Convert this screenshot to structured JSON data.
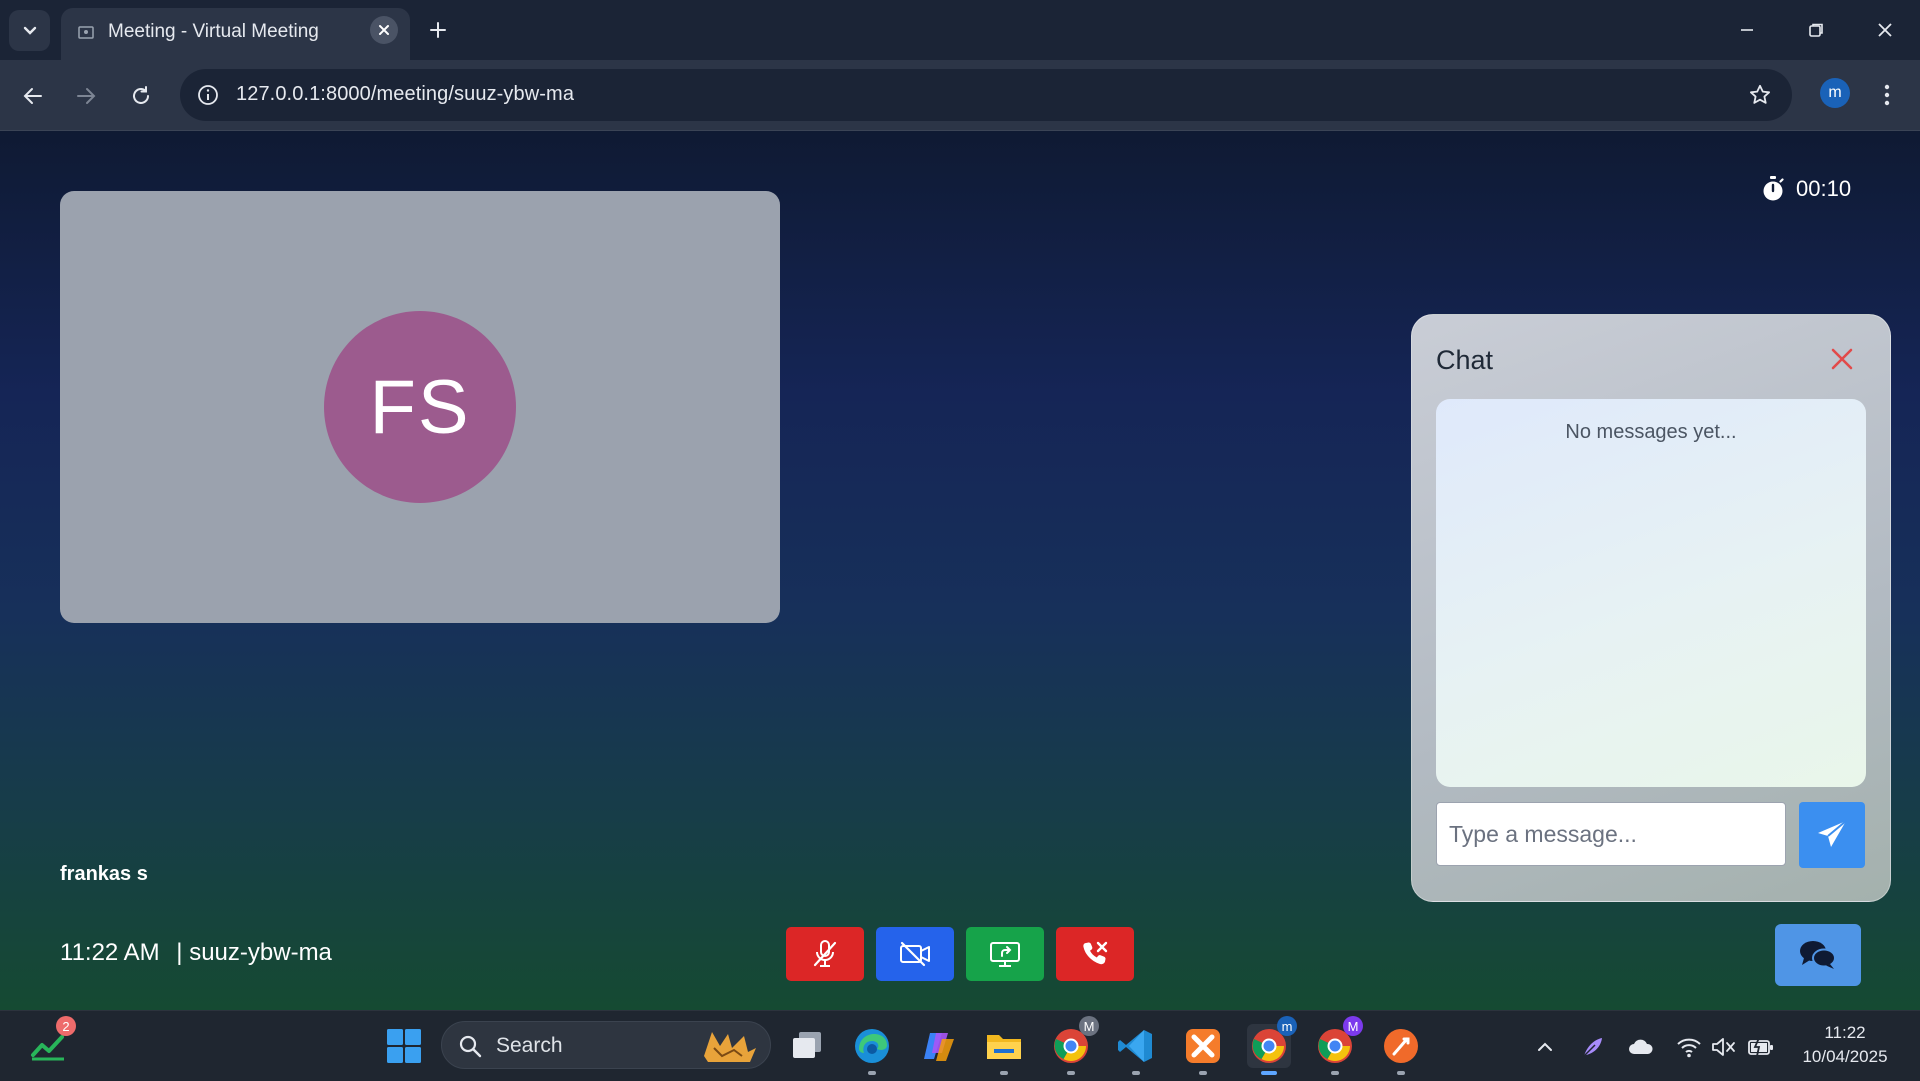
{
  "browser": {
    "tab_title": "Meeting - Virtual Meeting",
    "url": "127.0.0.1:8000/meeting/suuz-ybw-ma",
    "profile_initial": "m"
  },
  "meeting": {
    "timer": "00:10",
    "participant_initials": "FS",
    "participant_name": "frankas s",
    "time": "11:22 AM",
    "separator": "|",
    "meeting_code": "suuz-ybw-ma",
    "controls": [
      {
        "name": "mute",
        "icon": "mic-off-icon",
        "color": "#dc2626"
      },
      {
        "name": "camera",
        "icon": "camera-off-icon",
        "color": "#2563eb"
      },
      {
        "name": "share-screen",
        "icon": "share-screen-icon",
        "color": "#16a34a"
      },
      {
        "name": "leave",
        "icon": "phone-hangup-icon",
        "color": "#dc2626"
      }
    ]
  },
  "chat": {
    "title": "Chat",
    "empty_text": "No messages yet...",
    "input_placeholder": "Type a message...",
    "send_icon": "paper-plane-icon"
  },
  "taskbar": {
    "widget_badge": "2",
    "search_label": "Search",
    "clock_time": "11:22",
    "clock_date": "10/04/2025",
    "chrome_badge_m": "m",
    "chrome_badge_M": "M"
  },
  "colors": {
    "accent_blue": "#2563eb",
    "danger_red": "#dc2626",
    "success_green": "#16a34a",
    "avatar": "#9c5b8e"
  }
}
